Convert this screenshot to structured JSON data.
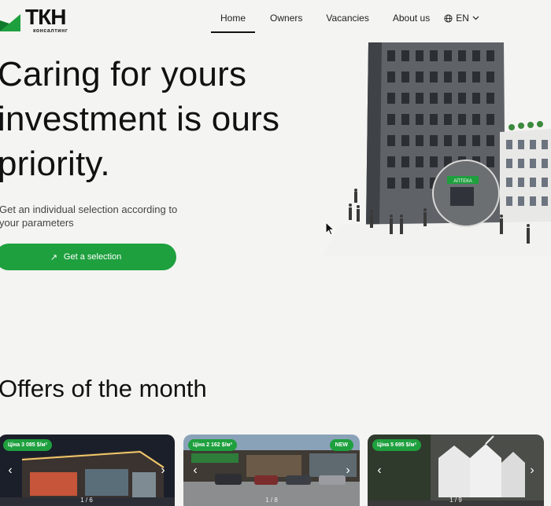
{
  "header": {
    "logo_text": "ТКН",
    "logo_sub": "консалтинг",
    "nav": [
      {
        "label": "Home",
        "active": true
      },
      {
        "label": "Owners"
      },
      {
        "label": "Vacancies"
      },
      {
        "label": "About us"
      }
    ],
    "lang": "EN"
  },
  "hero": {
    "title": "Caring for yours investment is ours priority.",
    "subtitle": "Get an individual selection according to your parameters",
    "cta_label": "Get a selection",
    "shop_sign": "АПТЕКА"
  },
  "offers": {
    "title": "Offers of the month",
    "cards": [
      {
        "price": "Ціна 3 085 $/м²",
        "pager": "1 / 6"
      },
      {
        "price": "Ціна 2 162 $/м²",
        "badge": "NEW",
        "pager": "1 / 8"
      },
      {
        "price": "Ціна 5 695 $/м²",
        "pager": "1 / 9"
      }
    ]
  },
  "colors": {
    "accent": "#1ea03e",
    "background": "#f4f4f2",
    "text": "#111111"
  },
  "icons": [
    "logo-mark-icon",
    "globe-icon",
    "chevron-down-icon",
    "arrow-up-right-icon",
    "chevron-left-icon",
    "chevron-right-icon",
    "mouse-cursor-icon"
  ]
}
